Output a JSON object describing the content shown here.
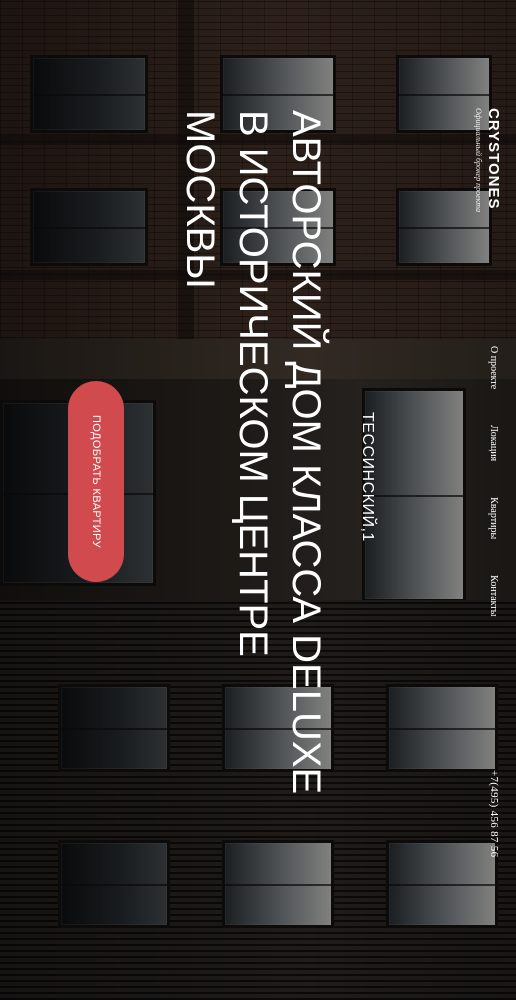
{
  "brand": {
    "logo": "CRYSTONES",
    "tagline": "Официальный брокер проекта"
  },
  "nav": [
    {
      "label": "О проекте"
    },
    {
      "label": "Локация"
    },
    {
      "label": "Квартиры"
    },
    {
      "label": "Контакты"
    }
  ],
  "phone": "+7(495) 456 87 56",
  "hero": {
    "address": "ТЕССИНСКИЙ,1",
    "title": "АВТОРСКИЙ ДОМ КЛАССА DELUXE В ИСТОРИЧЕСКОМ ЦЕНТРЕ МОСКВЫ",
    "cta_label": "ПОДОБРАТЬ КВАРТИРУ"
  },
  "colors": {
    "accent": "#d14a4d",
    "text": "#ffffff"
  }
}
